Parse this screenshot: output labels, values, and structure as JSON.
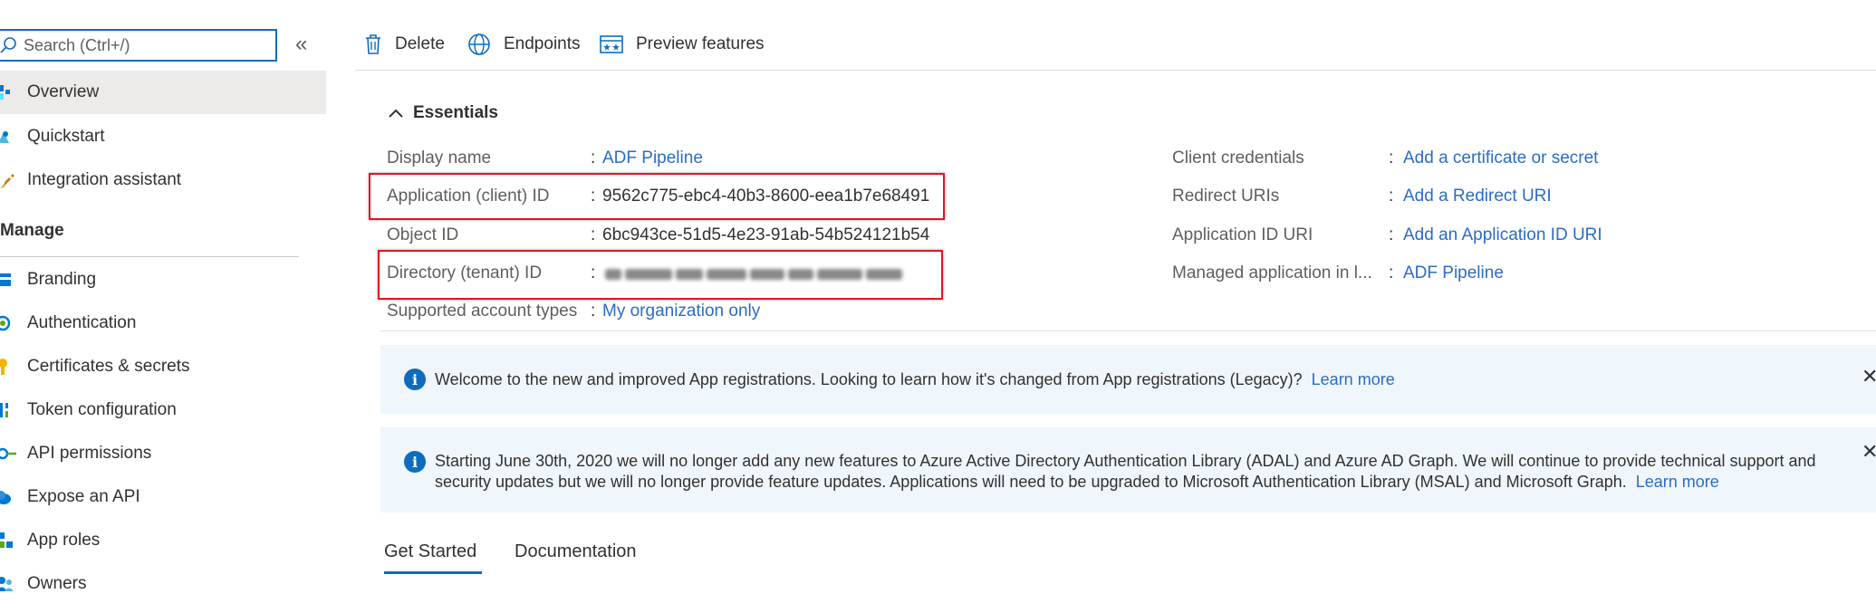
{
  "sidebar": {
    "search_placeholder": "Search (Ctrl+/)",
    "collapse_glyph": "«",
    "top_items": [
      {
        "label": "Overview",
        "icon": "overview-icon"
      },
      {
        "label": "Quickstart",
        "icon": "quickstart-icon"
      },
      {
        "label": "Integration assistant",
        "icon": "rocket-icon"
      }
    ],
    "section_header": "Manage",
    "manage_items": [
      {
        "label": "Branding",
        "icon": "branding-icon"
      },
      {
        "label": "Authentication",
        "icon": "authentication-icon"
      },
      {
        "label": "Certificates & secrets",
        "icon": "key-icon"
      },
      {
        "label": "Token configuration",
        "icon": "token-icon"
      },
      {
        "label": "API permissions",
        "icon": "api-permissions-icon"
      },
      {
        "label": "Expose an API",
        "icon": "cloud-icon"
      },
      {
        "label": "App roles",
        "icon": "app-roles-icon"
      },
      {
        "label": "Owners",
        "icon": "owners-icon"
      }
    ]
  },
  "toolbar": {
    "delete_label": "Delete",
    "endpoints_label": "Endpoints",
    "preview_label": "Preview features"
  },
  "essentials": {
    "title": "Essentials",
    "left": [
      {
        "label": "Display name",
        "value": "ADF Pipeline",
        "is_link": true
      },
      {
        "label": "Application (client) ID",
        "value": "9562c775-ebc4-40b3-8600-eea1b7e68491",
        "is_link": false
      },
      {
        "label": "Object ID",
        "value": "6bc943ce-51d5-4e23-91ab-54b524121b54",
        "is_link": false
      },
      {
        "label": "Directory (tenant) ID",
        "value": "",
        "is_link": false
      },
      {
        "label": "Supported account types",
        "value": "My organization only",
        "is_link": true
      }
    ],
    "right": [
      {
        "label": "Client credentials",
        "value": "Add a certificate or secret"
      },
      {
        "label": "Redirect URIs",
        "value": "Add a Redirect URI"
      },
      {
        "label": "Application ID URI",
        "value": "Add an Application ID URI"
      },
      {
        "label": "Managed application in l...",
        "value": "ADF Pipeline"
      }
    ],
    "colon": ":"
  },
  "banners": [
    {
      "text": "Welcome to the new and improved App registrations. Looking to learn how it's changed from App registrations (Legacy)?",
      "link": "Learn more"
    },
    {
      "text": "Starting June 30th, 2020 we will no longer add any new features to Azure Active Directory Authentication Library (ADAL) and Azure AD Graph. We will continue to provide technical support and security updates but we will no longer provide feature updates. Applications will need to be upgraded to Microsoft Authentication Library (MSAL) and Microsoft Graph.",
      "link": "Learn more"
    }
  ],
  "tabs": [
    {
      "label": "Get Started",
      "active": true
    },
    {
      "label": "Documentation",
      "active": false
    }
  ],
  "colors": {
    "accent": "#0f6cbd",
    "link": "#2b6cc4",
    "highlight": "#e81123",
    "banner_bg": "#eff6fc",
    "selected_bg": "#edebe9"
  }
}
